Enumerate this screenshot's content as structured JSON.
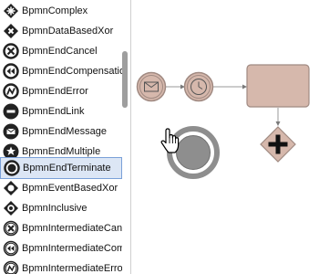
{
  "palette": {
    "items": [
      {
        "label": "BpmnComplex",
        "icon": "complex-gateway-icon"
      },
      {
        "label": "BpmnDataBasedXor",
        "icon": "data-based-xor-icon"
      },
      {
        "label": "BpmnEndCancel",
        "icon": "end-cancel-icon"
      },
      {
        "label": "BpmnEndCompensation",
        "icon": "end-compensation-icon"
      },
      {
        "label": "BpmnEndError",
        "icon": "end-error-icon"
      },
      {
        "label": "BpmnEndLink",
        "icon": "end-link-icon"
      },
      {
        "label": "BpmnEndMessage",
        "icon": "end-message-icon"
      },
      {
        "label": "BpmnEndMultiple",
        "icon": "end-multiple-icon"
      },
      {
        "label": "BpmnEndTerminate",
        "icon": "end-terminate-icon",
        "selected": true
      },
      {
        "label": "BpmnEventBasedXor",
        "icon": "event-based-xor-icon"
      },
      {
        "label": "BpmnInclusive",
        "icon": "inclusive-gateway-icon"
      },
      {
        "label": "BpmnIntermediateCancel",
        "icon": "intermediate-cancel-icon"
      },
      {
        "label": "BpmnIntermediateCompensation",
        "icon": "intermediate-compensation-icon"
      },
      {
        "label": "BpmnIntermediateError",
        "icon": "intermediate-error-icon"
      }
    ]
  },
  "colors": {
    "shape_fill": "#d6b8ac",
    "shape_stroke": "#a08a82",
    "gray_fill": "#8e8e8e",
    "selection": "#dce6f5"
  }
}
